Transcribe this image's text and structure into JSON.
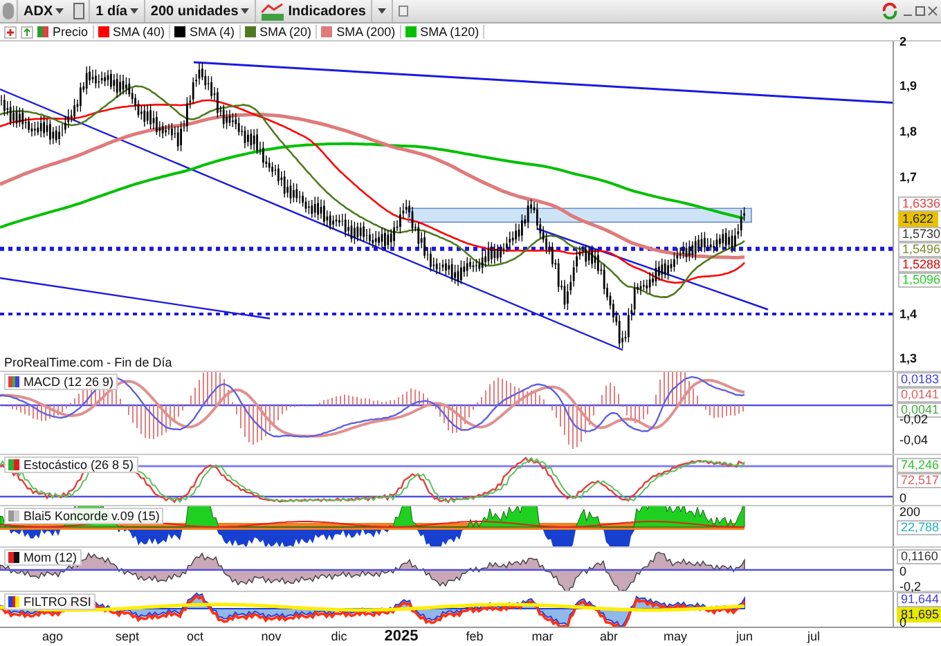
{
  "toolbar": {
    "symbol": "ADX",
    "period": "1 día",
    "units": "200 unidades",
    "indicators": "Indicadores"
  },
  "legend": [
    {
      "label": "Precio",
      "color": "#2e9a2e"
    },
    {
      "label": "SMA (40)",
      "color": "#ff0000"
    },
    {
      "label": "SMA (4)",
      "color": "#000000"
    },
    {
      "label": "SMA (20)",
      "color": "#4f7a1f"
    },
    {
      "label": "SMA (200)",
      "color": "#e07a7a"
    },
    {
      "label": "SMA (120)",
      "color": "#00c000"
    }
  ],
  "main": {
    "source": "ProRealTime.com - Fin de Día",
    "y_ticks": [
      "2",
      "1,9",
      "1,8",
      "1,7",
      "1,4",
      "1,3"
    ],
    "value_tags": [
      {
        "text": "1,6336",
        "color": "#e04040",
        "kind": "outline"
      },
      {
        "text": "1,622",
        "color": "#e8c000",
        "kind": "filled"
      },
      {
        "text": "1,5730",
        "color": "#333333",
        "kind": "outline"
      },
      {
        "text": "1,5496",
        "color": "#7a8a2a",
        "kind": "outline"
      },
      {
        "text": "1,5288",
        "color": "#e00000",
        "kind": "outline"
      },
      {
        "text": "1,5096",
        "color": "#20d020",
        "kind": "outline"
      }
    ]
  },
  "panels": [
    {
      "kind": "macd",
      "title": "MACD (12 26 9)",
      "value_tags": [
        {
          "text": "0,0183",
          "color": "#4040e0",
          "kind": "outline"
        },
        {
          "text": "0,0141",
          "color": "#e06060",
          "kind": "outline"
        },
        {
          "text": "0,0041",
          "color": "#40b040",
          "kind": "outline"
        }
      ],
      "y_ticks": [
        "-0,02",
        "-0,04"
      ]
    },
    {
      "kind": "stochastic",
      "title": "Estocástico (26 8 5)",
      "value_tags": [
        {
          "text": "74,246",
          "color": "#30c030",
          "kind": "outline"
        },
        {
          "text": "72,517",
          "color": "#e06060",
          "kind": "outline"
        }
      ],
      "y_ticks": [
        "0"
      ]
    },
    {
      "kind": "koncorde",
      "title": "Blai5 Koncorde v.09 (15)",
      "value_tags": [
        {
          "text": "22,788",
          "color": "#20b0c0",
          "kind": "outline"
        }
      ],
      "y_ticks": [
        "200"
      ]
    },
    {
      "kind": "momentum",
      "title": "Mom (12)",
      "value_tags": [
        {
          "text": "0,1160",
          "color": "#333333",
          "kind": "outline"
        }
      ],
      "y_ticks": [
        "0",
        "-0,2"
      ]
    },
    {
      "kind": "rsi",
      "title": "FILTRO RSI",
      "value_tags": [
        {
          "text": "91,644",
          "color": "#4040e0",
          "kind": "outline"
        },
        {
          "text": "81,695",
          "color": "#e8e800",
          "kind": "filled"
        }
      ],
      "y_ticks": [
        "0"
      ]
    }
  ],
  "x_axis": [
    {
      "label": "ago",
      "year": false
    },
    {
      "label": "sept",
      "year": false
    },
    {
      "label": "oct",
      "year": false
    },
    {
      "label": "nov",
      "year": false
    },
    {
      "label": "dic",
      "year": false
    },
    {
      "label": "2025",
      "year": true
    },
    {
      "label": "feb",
      "year": false
    },
    {
      "label": "mar",
      "year": false
    },
    {
      "label": "abr",
      "year": false
    },
    {
      "label": "may",
      "year": false
    },
    {
      "label": "jun",
      "year": false
    },
    {
      "label": "jul",
      "year": false
    }
  ]
}
